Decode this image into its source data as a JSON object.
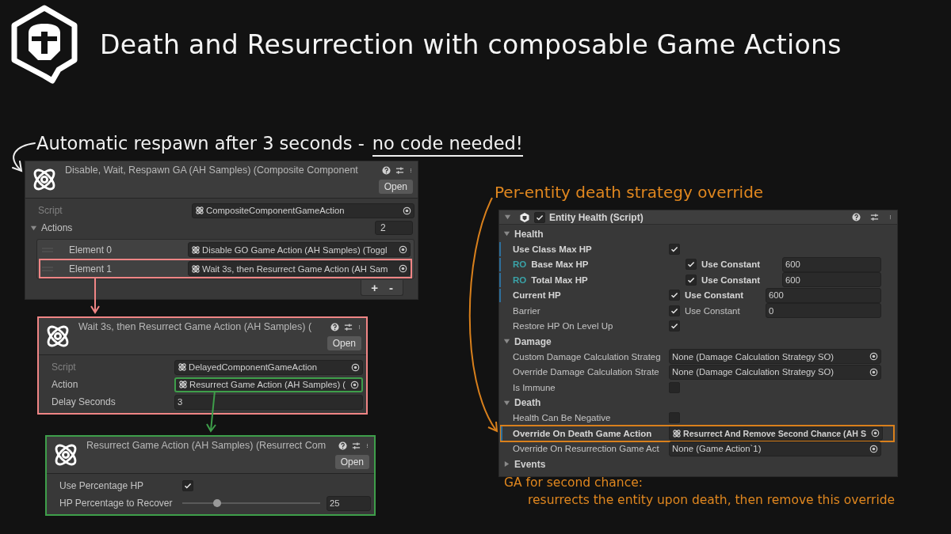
{
  "header": {
    "title": "Death and Resurrection with composable Game Actions"
  },
  "respawn_note": {
    "text": "Automatic respawn after 3 seconds -",
    "underlined": "no code needed!"
  },
  "composite_panel": {
    "title": "Disable, Wait, Respawn GA (AH Samples) (Composite Component",
    "open_button": "Open",
    "rows": [
      {
        "kind": "object",
        "label": "Script",
        "value": "CompositeComponentGameAction",
        "disabled": true,
        "icon": true
      },
      {
        "kind": "list",
        "label": "Actions",
        "count": "2",
        "expanded": true
      },
      {
        "kind": "element",
        "label": "Element 0",
        "value": "Disable GO Game Action (AH Samples) (Toggl",
        "highlighted": false
      },
      {
        "kind": "element",
        "label": "Element 1",
        "value": "Wait 3s, then Resurrect Game Action (AH Sam",
        "highlighted": true,
        "color": "#f08585"
      }
    ],
    "add_button": "+",
    "remove_button": "-"
  },
  "delayed_panel": {
    "color": "#f08585",
    "title": "Wait 3s, then Resurrect Game Action (AH Samples) (",
    "open_button": "Open",
    "rows": [
      {
        "kind": "object",
        "label": "Script",
        "value": "DelayedComponentGameAction",
        "disabled": true,
        "icon": true
      },
      {
        "kind": "object",
        "label": "Action",
        "value": "Resurrect Game Action (AH Samples) (",
        "icon": true,
        "highlighted": true,
        "color": "#3e9e4a"
      },
      {
        "kind": "number",
        "label": "Delay Seconds",
        "value": "3"
      }
    ]
  },
  "resurrect_panel": {
    "color": "#3e9e4a",
    "title": "Resurrect Game Action (AH Samples) (Resurrect Com",
    "open_button": "Open",
    "rows": [
      {
        "kind": "checkbox",
        "label": "Use Percentage HP",
        "checked": true
      },
      {
        "kind": "slider",
        "label": "HP Percentage to Recover",
        "level": 0.25,
        "value": "25"
      }
    ]
  },
  "override_note": {
    "text": "Per-entity death strategy override"
  },
  "entity_panel": {
    "title": "Entity Health (Script)",
    "enabled": true,
    "expanded": true,
    "sections": [
      {
        "label": "Health",
        "expanded": true,
        "rows": [
          {
            "kind": "checkbox",
            "label": "Use Class Max HP",
            "checked": true,
            "modified": true
          },
          {
            "kind": "constant",
            "prefix": "RO",
            "label": "Base Max HP",
            "checked": true,
            "option": "Use Constant",
            "value": "600",
            "disabled": true,
            "modified": true
          },
          {
            "kind": "constant",
            "prefix": "RO",
            "label": "Total Max HP",
            "checked": true,
            "option": "Use Constant",
            "value": "600",
            "disabled": true,
            "modified": true
          },
          {
            "kind": "constant",
            "label": "Current HP",
            "checked": true,
            "option": "Use Constant",
            "value": "600",
            "modified": true
          },
          {
            "kind": "constant",
            "label": "Barrier",
            "checked": true,
            "option": "Use Constant",
            "value": "0",
            "modified": false
          },
          {
            "kind": "checkbox",
            "label": "Restore HP On Level Up",
            "checked": true,
            "modified": false
          }
        ]
      },
      {
        "label": "Damage",
        "expanded": true,
        "rows": [
          {
            "kind": "object",
            "label": "Custom Damage Calculation Strateg",
            "value": "None (Damage Calculation Strategy SO)"
          },
          {
            "kind": "object",
            "label": "Override Damage Calculation Strate",
            "value": "None (Damage Calculation Strategy SO)"
          },
          {
            "kind": "checkbox",
            "label": "Is Immune",
            "checked": false,
            "modified": false
          }
        ]
      },
      {
        "label": "Death",
        "expanded": true,
        "rows": [
          {
            "kind": "checkbox",
            "label": "Health Can Be Negative",
            "checked": false,
            "modified": false
          },
          {
            "kind": "object",
            "label": "Override On Death Game Action",
            "value": "Resurrect And Remove Second Chance (AH S",
            "icon": true,
            "modified": true,
            "highlighted": true,
            "color": "#d9801c"
          },
          {
            "kind": "object",
            "label": "Override On Resurrection Game Act",
            "value": "None (Game Action`1)"
          }
        ]
      },
      {
        "label": "Events",
        "expanded": false
      }
    ]
  },
  "second_chance_note": {
    "lines": [
      "GA for second chance:",
      "resurrects the entity upon death, then remove this override"
    ]
  }
}
